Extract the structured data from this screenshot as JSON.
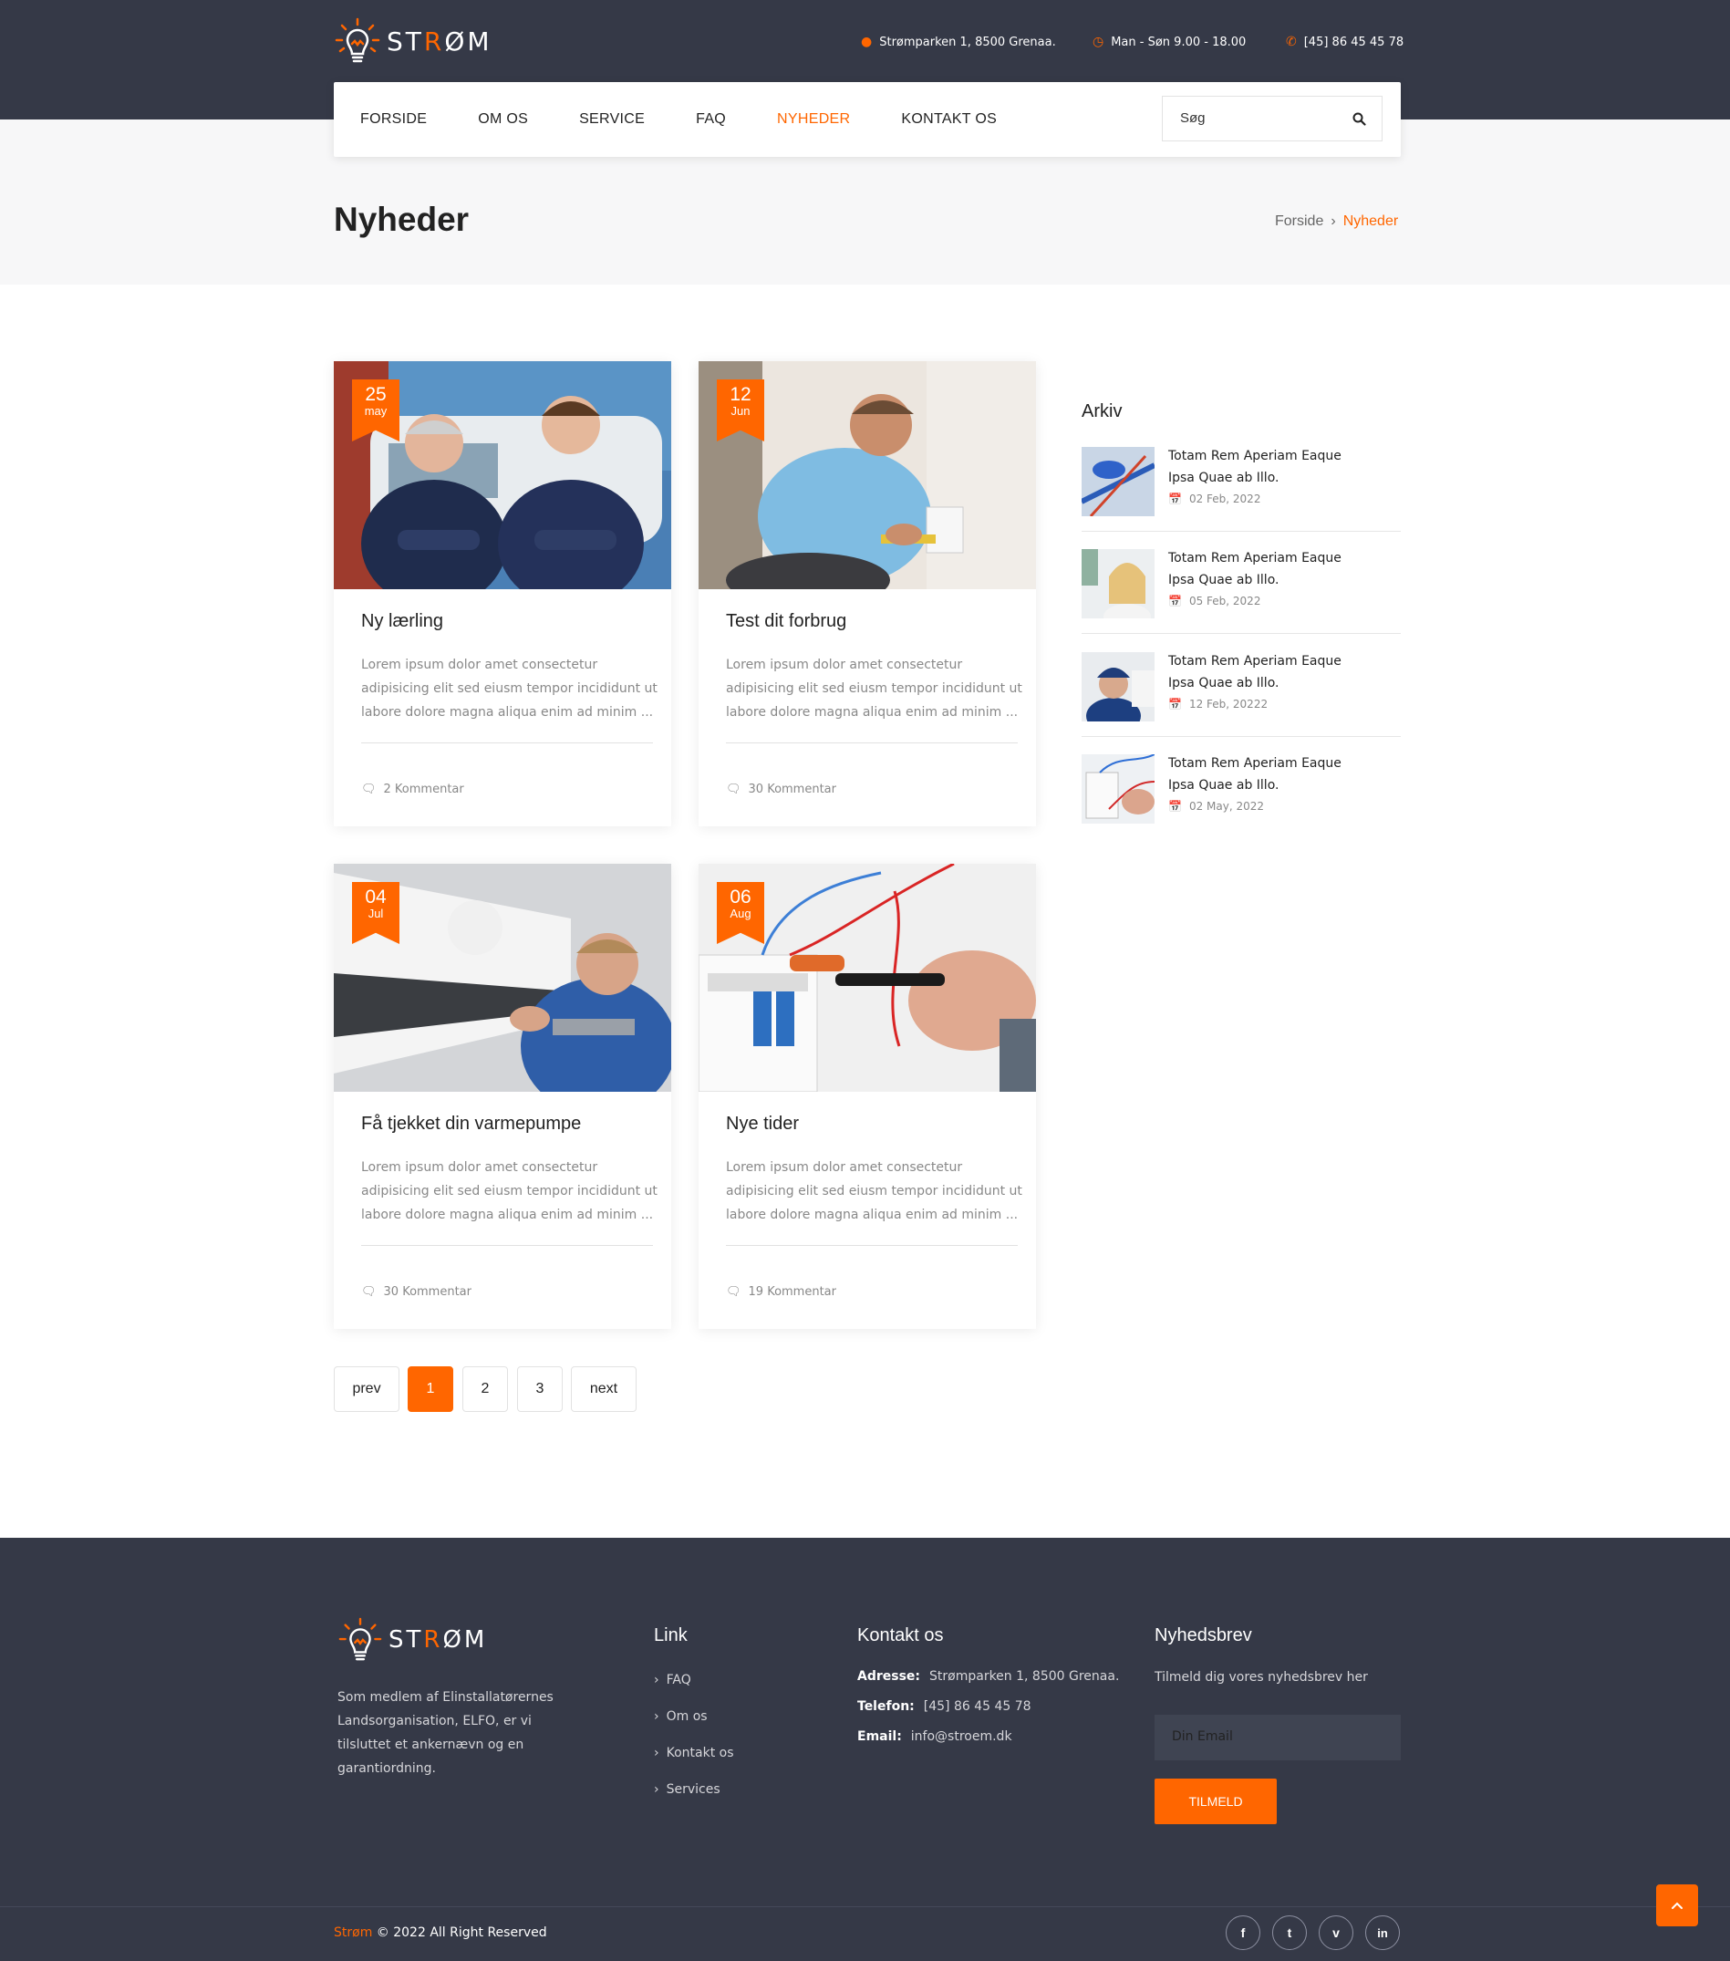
{
  "brand": {
    "name_pre": "ST",
    "name_accent": "R",
    "name_post": "ØM"
  },
  "topbar": {
    "address": "Strømparken 1, 8500 Grenaa.",
    "hours": "Man - Søn 9.00 - 18.00",
    "phone": "[45] 86 45 45 78"
  },
  "nav": {
    "items": [
      {
        "label": "FORSIDE"
      },
      {
        "label": "OM OS"
      },
      {
        "label": "SERVICE"
      },
      {
        "label": "FAQ"
      },
      {
        "label": "NYHEDER",
        "active": true
      },
      {
        "label": "KONTAKT OS"
      }
    ],
    "search_placeholder": "Søg"
  },
  "page": {
    "title": "Nyheder",
    "breadcrumb": [
      "Forside",
      "Nyheder"
    ]
  },
  "posts": [
    {
      "day": "25",
      "month": "may",
      "title": "Ny lærling",
      "excerpt": "Lorem ipsum dolor amet consectetur adipisicing elit sed eiusm tempor incididunt ut labore dolore magna aliqua enim ad minim ...",
      "comments": "2 Kommentar"
    },
    {
      "day": "12",
      "month": "Jun",
      "title": "Test dit forbrug",
      "excerpt": "Lorem ipsum dolor amet consectetur adipisicing elit sed eiusm tempor incididunt ut labore dolore magna aliqua enim ad minim ...",
      "comments": "30 Kommentar"
    },
    {
      "day": "04",
      "month": "Jul",
      "title": "Få tjekket din varmepumpe",
      "excerpt": "Lorem ipsum dolor amet consectetur adipisicing elit sed eiusm tempor incididunt ut labore dolore magna aliqua enim ad minim ...",
      "comments": "30 Kommentar"
    },
    {
      "day": "06",
      "month": "Aug",
      "title": "Nye tider",
      "excerpt": "Lorem ipsum dolor amet consectetur adipisicing elit sed eiusm tempor incididunt ut labore dolore magna aliqua enim ad minim ...",
      "comments": "19 Kommentar"
    }
  ],
  "sidebar": {
    "title": "Arkiv",
    "items": [
      {
        "title": "Totam Rem Aperiam Eaque Ipsa Quae ab Illo.",
        "date": "02 Feb, 2022"
      },
      {
        "title": "Totam Rem Aperiam Eaque Ipsa Quae ab Illo.",
        "date": "05 Feb, 2022"
      },
      {
        "title": "Totam Rem Aperiam Eaque Ipsa Quae ab Illo.",
        "date": "12 Feb, 20222"
      },
      {
        "title": "Totam Rem Aperiam Eaque Ipsa Quae ab Illo.",
        "date": "02 May, 2022"
      }
    ]
  },
  "pagination": {
    "prev": "prev",
    "pages": [
      "1",
      "2",
      "3"
    ],
    "current": "1",
    "next": "next"
  },
  "footer": {
    "about": "Som medlem af Elinstallatørernes Landsorganisation, ELFO, er vi tilsluttet et ankernævn og en garantiordning.",
    "links_title": "Link",
    "links": [
      "FAQ",
      "Om os",
      "Kontakt os",
      "Services"
    ],
    "contact_title": "Kontakt os",
    "contact": [
      {
        "label": "Adresse:",
        "value": "Strømparken 1, 8500 Grenaa."
      },
      {
        "label": "Telefon:",
        "value": "[45] 86 45 45 78"
      },
      {
        "label": "Email:",
        "value": "info@stroem.dk"
      }
    ],
    "newsletter_title": "Nyhedsbrev",
    "newsletter_text": "Tilmeld dig vores nyhedsbrev her",
    "email_placeholder": "Din Email",
    "subscribe": "TILMELD",
    "copyright_brand": "Strøm",
    "copyright_rest": " © 2022 All Right Reserved",
    "social": [
      "f",
      "t",
      "v",
      "in"
    ]
  },
  "colors": {
    "accent": "#ff6600",
    "dark": "#353947",
    "light_bg": "#f7f7f8"
  }
}
